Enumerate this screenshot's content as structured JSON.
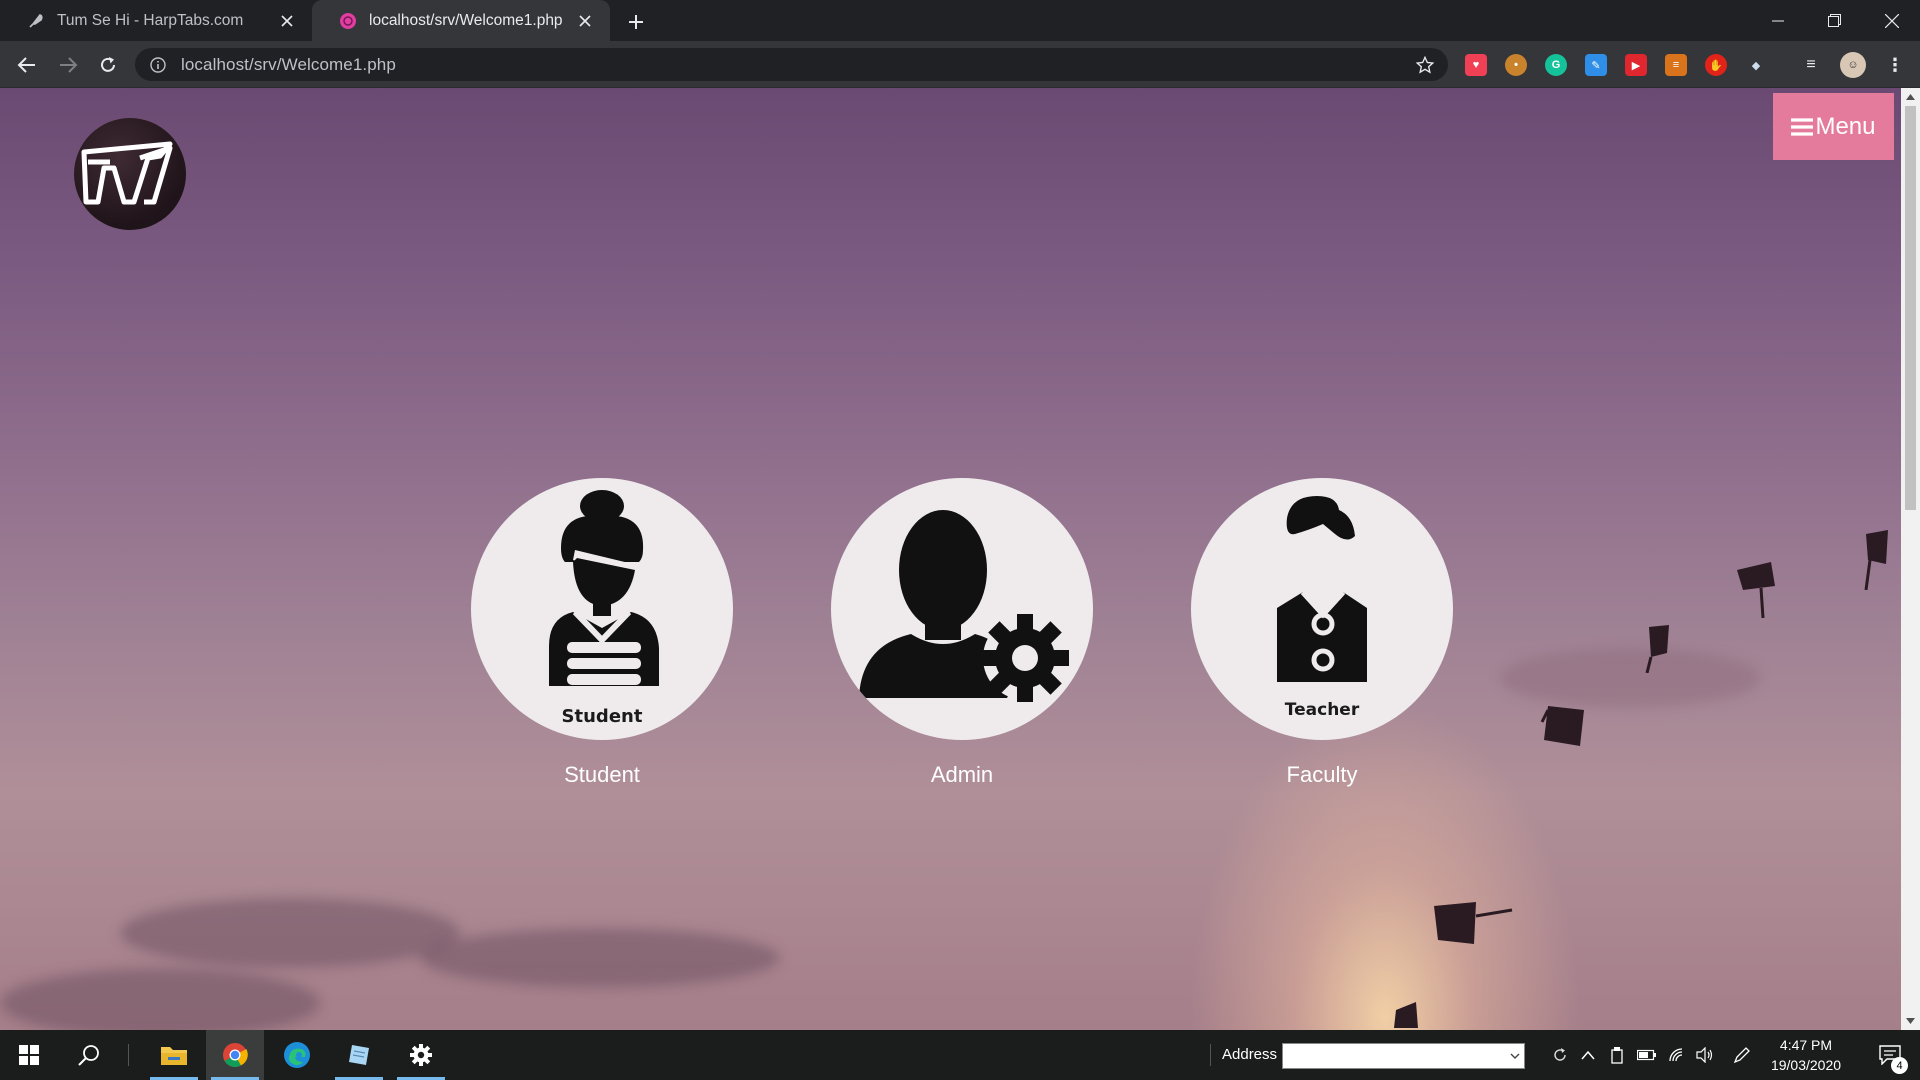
{
  "browser": {
    "tabs": [
      {
        "title": "Tum Se Hi - HarpTabs.com",
        "active": false,
        "favicon": "feather-icon"
      },
      {
        "title": "localhost/srv/Welcome1.php",
        "active": true,
        "favicon": "pink-globe-icon"
      }
    ],
    "url": "localhost/srv/Welcome1.php",
    "extensions": [
      "pocket-icon",
      "cookie-icon",
      "grammarly-icon",
      "notes-icon",
      "youtube-icon",
      "app-grid-icon",
      "adblock-icon",
      "shield-icon",
      "media-queue-icon",
      "profile-avatar"
    ]
  },
  "page": {
    "logo_alt": "SRV",
    "menu_label": "Menu",
    "roles": [
      {
        "id": "student",
        "caption": "Student",
        "label": "Student"
      },
      {
        "id": "admin",
        "caption": "",
        "label": "Admin"
      },
      {
        "id": "faculty",
        "caption": "Teacher",
        "label": "Faculty"
      }
    ]
  },
  "taskbar": {
    "address_label": "Address",
    "time": "4:47 PM",
    "date": "19/03/2020",
    "notification_count": "4"
  },
  "colors": {
    "menu_button": "#e47a9c",
    "role_circle": "#efebec",
    "tab_active": "#35363a",
    "chrome_dark": "#202124"
  }
}
